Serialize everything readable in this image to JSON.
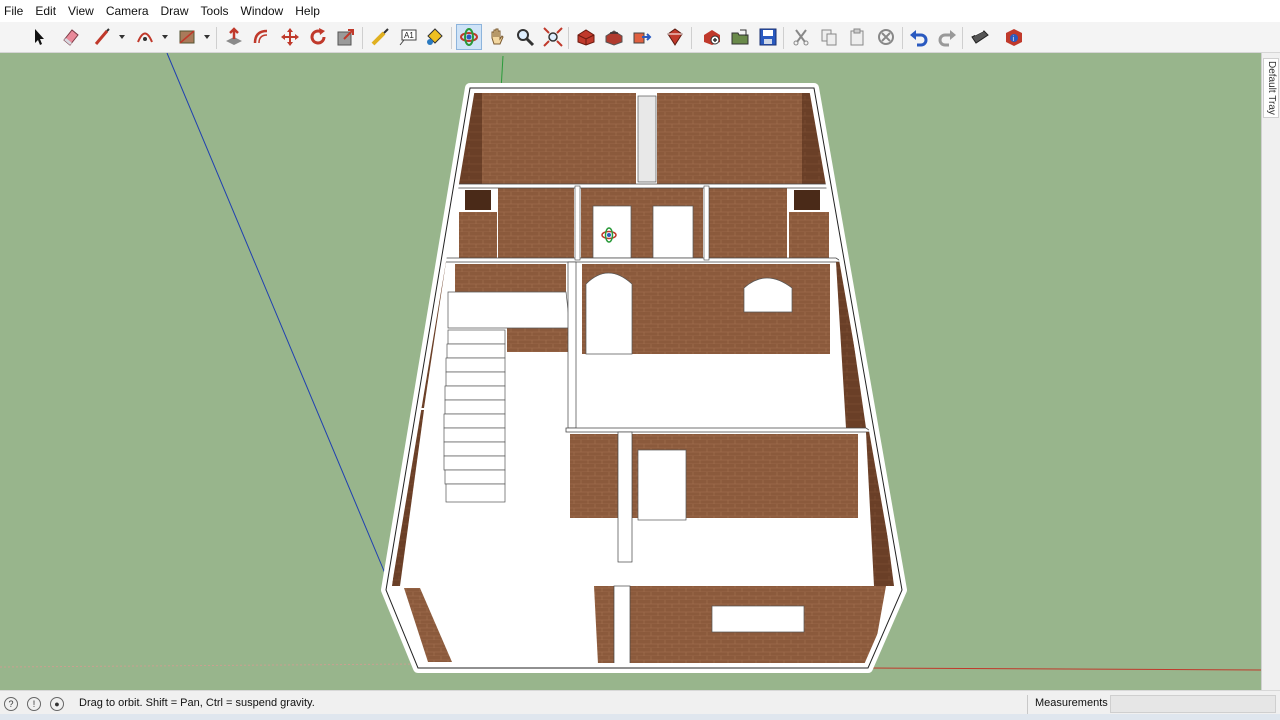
{
  "menu": [
    "File",
    "Edit",
    "View",
    "Camera",
    "Draw",
    "Tools",
    "Window",
    "Help"
  ],
  "toolbar": {
    "tools": [
      {
        "name": "select-tool-icon",
        "tooltip": "Select"
      },
      {
        "name": "eraser-tool-icon",
        "tooltip": "Eraser"
      },
      {
        "name": "line-tool-icon",
        "tooltip": "Line"
      },
      {
        "name": "arc-tool-icon",
        "tooltip": "Arc"
      },
      {
        "name": "rectangle-tool-icon",
        "tooltip": "Rectangle"
      },
      {
        "name": "push-pull-tool-icon",
        "tooltip": "Push/Pull"
      },
      {
        "name": "offset-tool-icon",
        "tooltip": "Offset"
      },
      {
        "name": "move-tool-icon",
        "tooltip": "Move"
      },
      {
        "name": "rotate-tool-icon",
        "tooltip": "Rotate"
      },
      {
        "name": "scale-tool-icon",
        "tooltip": "Scale"
      },
      {
        "name": "tape-measure-tool-icon",
        "tooltip": "Tape Measure"
      },
      {
        "name": "text-tool-icon",
        "tooltip": "Text"
      },
      {
        "name": "paint-bucket-tool-icon",
        "tooltip": "Paint Bucket"
      },
      {
        "name": "orbit-tool-icon",
        "tooltip": "Orbit"
      },
      {
        "name": "pan-tool-icon",
        "tooltip": "Pan"
      },
      {
        "name": "zoom-tool-icon",
        "tooltip": "Zoom"
      },
      {
        "name": "zoom-extents-tool-icon",
        "tooltip": "Zoom Extents"
      },
      {
        "name": "3d-warehouse-icon",
        "tooltip": "3D Warehouse"
      },
      {
        "name": "share-model-icon",
        "tooltip": "Share Model"
      },
      {
        "name": "share-component-icon",
        "tooltip": "Share Component"
      },
      {
        "name": "extension-warehouse-icon",
        "tooltip": "Extension Warehouse"
      },
      {
        "name": "new-file-icon",
        "tooltip": "New"
      },
      {
        "name": "open-file-icon",
        "tooltip": "Open"
      },
      {
        "name": "save-file-icon",
        "tooltip": "Save"
      },
      {
        "name": "cut-icon",
        "tooltip": "Cut"
      },
      {
        "name": "copy-icon",
        "tooltip": "Copy"
      },
      {
        "name": "paste-icon",
        "tooltip": "Paste"
      },
      {
        "name": "delete-icon",
        "tooltip": "Erase"
      },
      {
        "name": "undo-icon",
        "tooltip": "Undo"
      },
      {
        "name": "redo-icon",
        "tooltip": "Redo"
      },
      {
        "name": "print-icon",
        "tooltip": "Print"
      },
      {
        "name": "model-info-icon",
        "tooltip": "Model Info"
      }
    ],
    "active_tool": "Orbit"
  },
  "tray": {
    "label": "Default Tray"
  },
  "status": {
    "message": "Drag to orbit. Shift = Pan, Ctrl = suspend gravity.",
    "measurements_label": "Measurements",
    "measurements_value": ""
  },
  "colors": {
    "viewport_bg": "#98b58c",
    "brick": "#8b5a3c",
    "wall_top": "#ffffff",
    "floor": "#ffffff",
    "axis_blue": "#1f3fb0",
    "axis_green": "#2a9a3a",
    "axis_red": "#c0392b"
  }
}
